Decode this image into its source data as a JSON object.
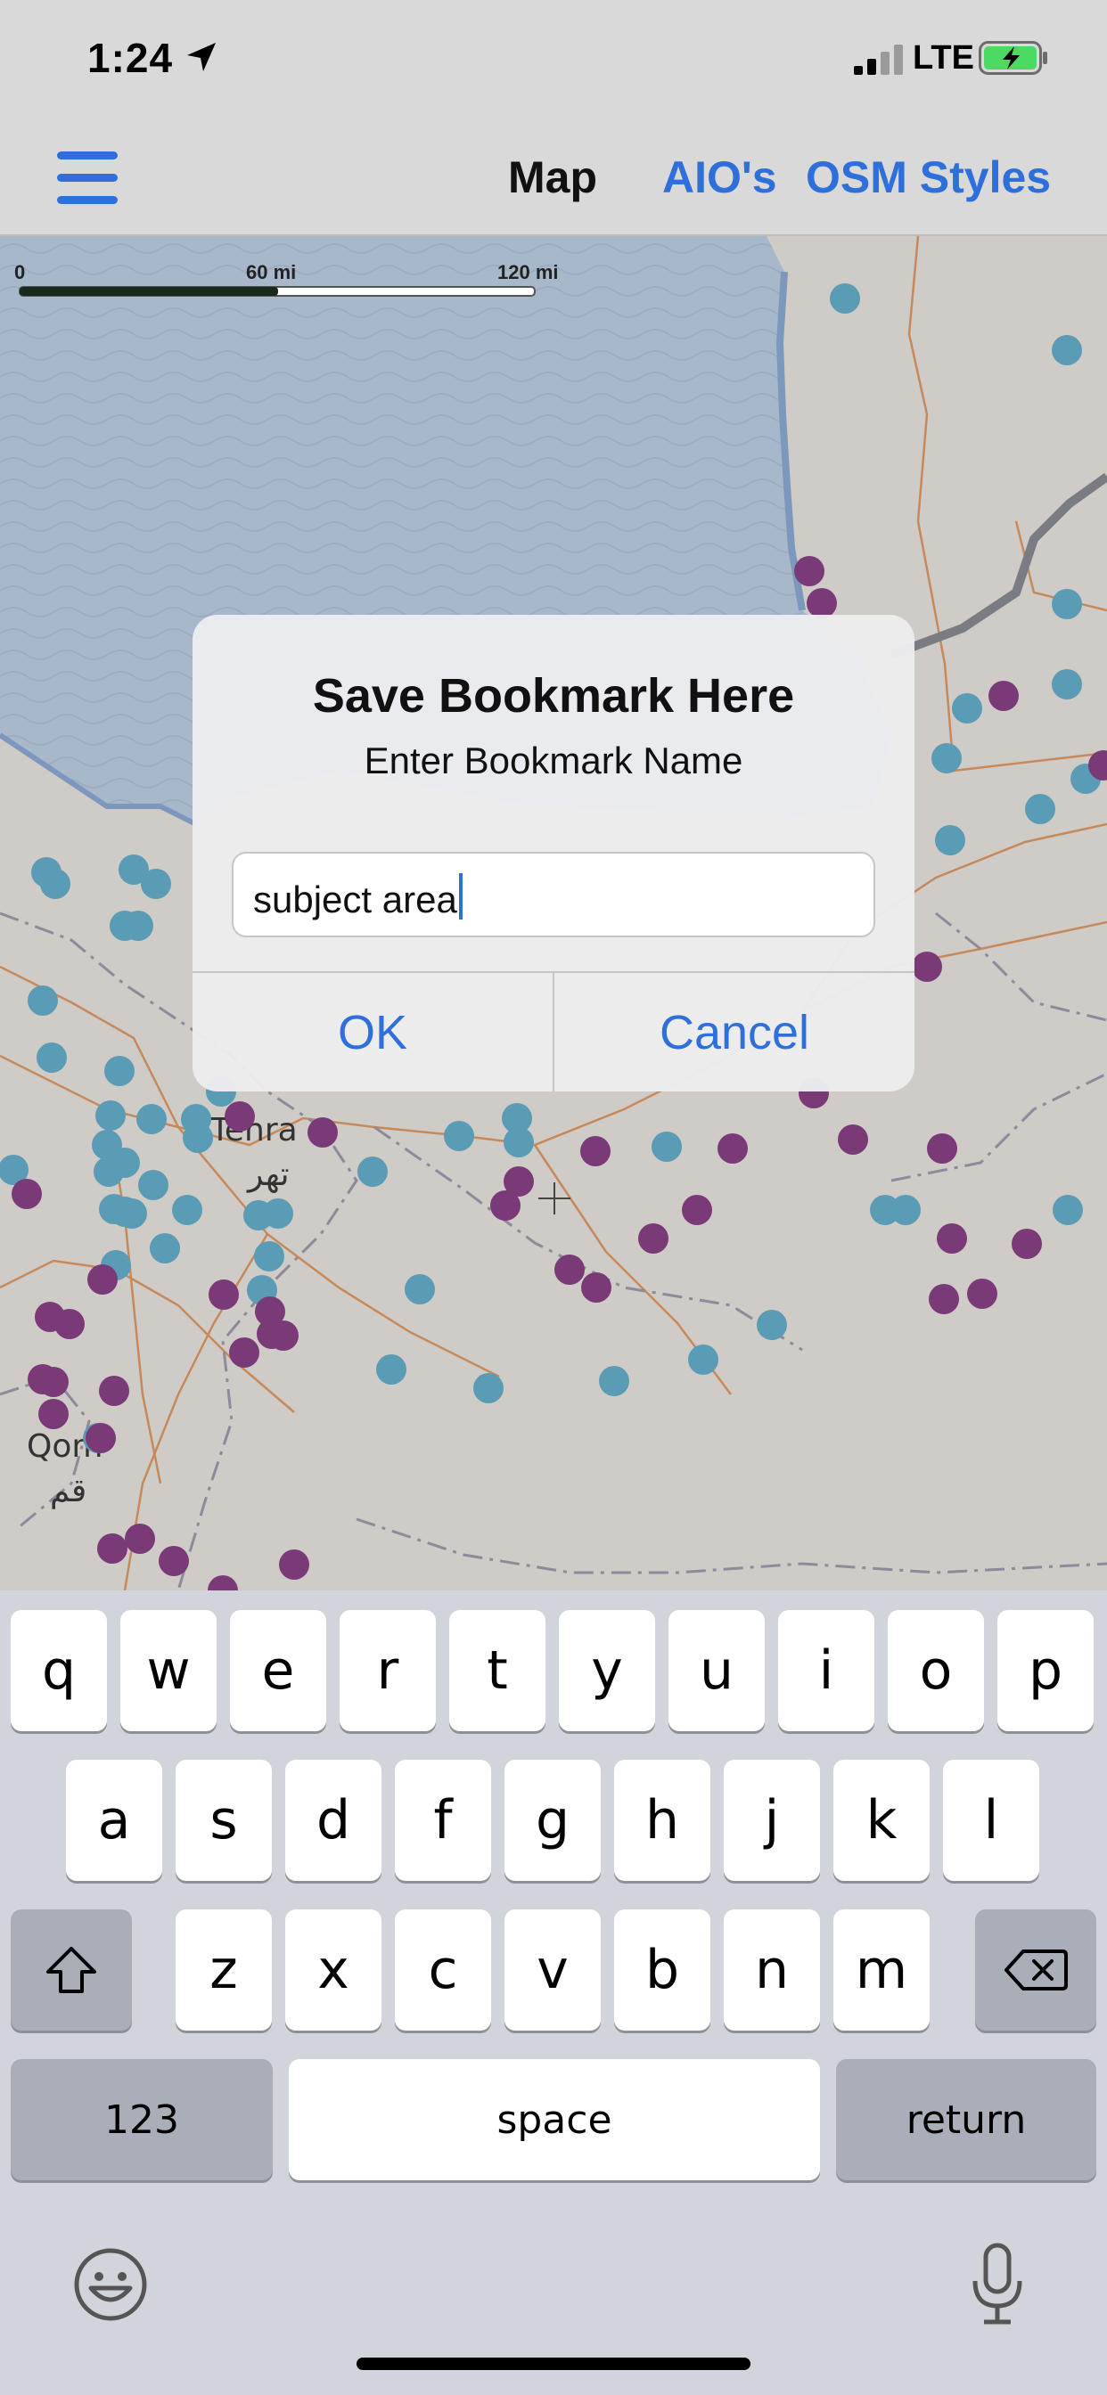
{
  "status": {
    "time": "1:24",
    "network": "LTE",
    "icons": [
      "location-arrow-icon",
      "signal-icon",
      "battery-charging-icon"
    ]
  },
  "nav": {
    "title": "Map",
    "links": [
      "AIO's",
      "OSM Styles"
    ],
    "menu_icon": "hamburger-menu-icon",
    "accent": "#2e6fd9"
  },
  "map": {
    "scale": {
      "start": "0",
      "mid": "60 mi",
      "end": "120 mi"
    },
    "cities": [
      {
        "latin": "Tehra",
        "local": "تهر"
      },
      {
        "latin": "Qom",
        "local": "قم"
      }
    ],
    "marker_colors": {
      "teal": "#5a9bb5",
      "purple": "#7a3a78"
    },
    "water_color": "#a8b8cb"
  },
  "dialog": {
    "title": "Save Bookmark Here",
    "message": "Enter Bookmark Name",
    "input_value": "subject area",
    "ok_label": "OK",
    "cancel_label": "Cancel"
  },
  "keyboard": {
    "row1": [
      "q",
      "w",
      "e",
      "r",
      "t",
      "y",
      "u",
      "i",
      "o",
      "p"
    ],
    "row2": [
      "a",
      "s",
      "d",
      "f",
      "g",
      "h",
      "j",
      "k",
      "l"
    ],
    "row3": [
      "z",
      "x",
      "c",
      "v",
      "b",
      "n",
      "m"
    ],
    "numbers_label": "123",
    "space_label": "space",
    "return_label": "return",
    "icons": [
      "shift-icon",
      "backspace-icon",
      "emoji-icon",
      "microphone-icon"
    ]
  }
}
